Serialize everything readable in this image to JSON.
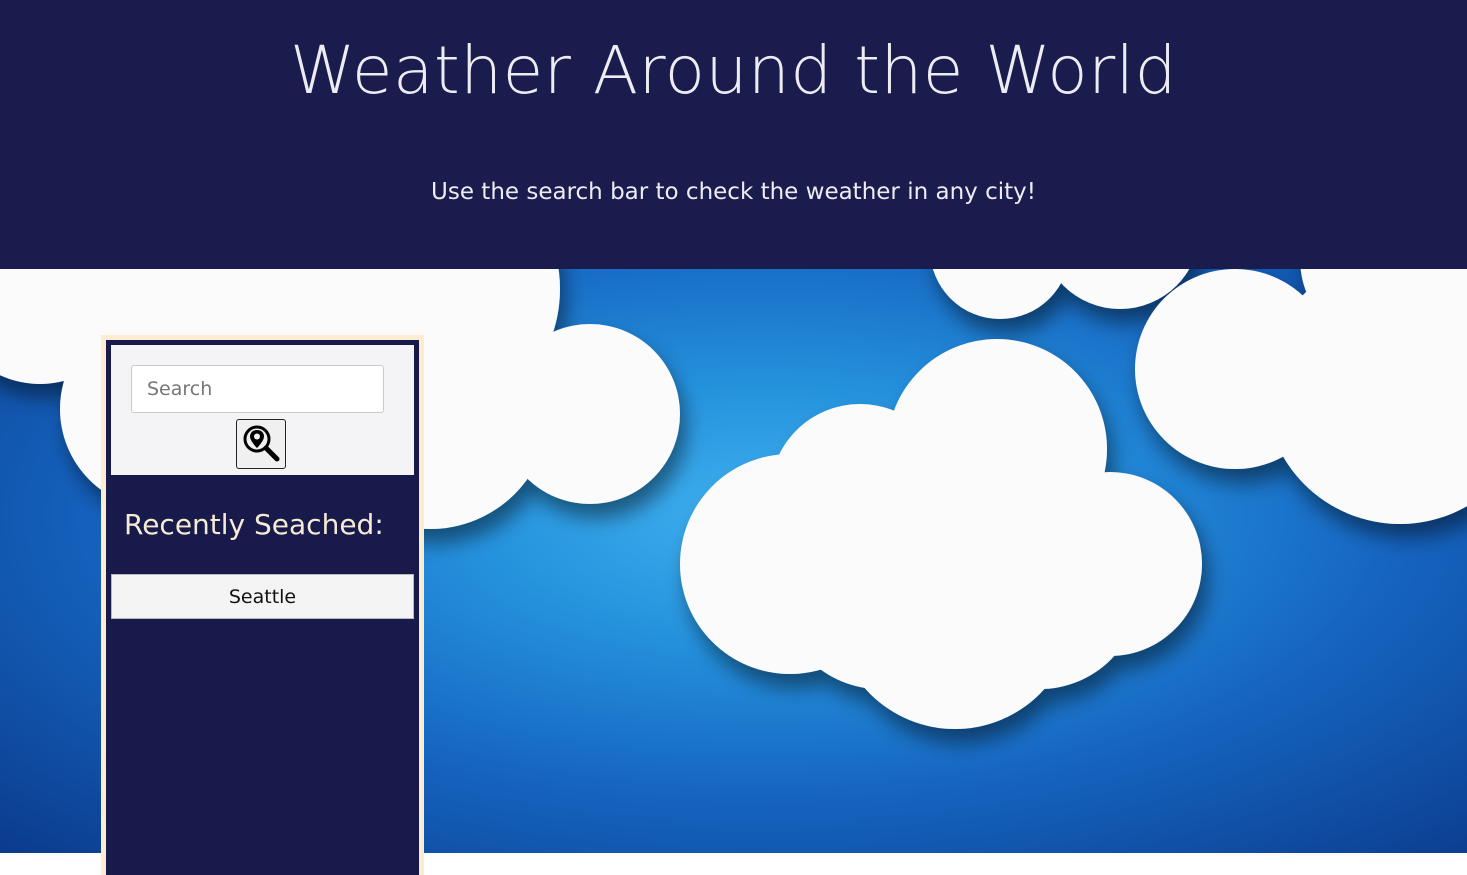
{
  "header": {
    "title": "Weather Around the World",
    "subtitle": "Use the search bar to check the weather in any city!"
  },
  "search": {
    "placeholder": "Search",
    "value": "",
    "button_icon": "location-search-icon"
  },
  "recent": {
    "title": "Recently Seached:",
    "cities": [
      "Seattle"
    ]
  },
  "colors": {
    "header_bg": "#1a1c4e",
    "panel_bg": "#171a4a",
    "panel_border": "#fcecd2",
    "sky_blue": "#2490dc"
  }
}
